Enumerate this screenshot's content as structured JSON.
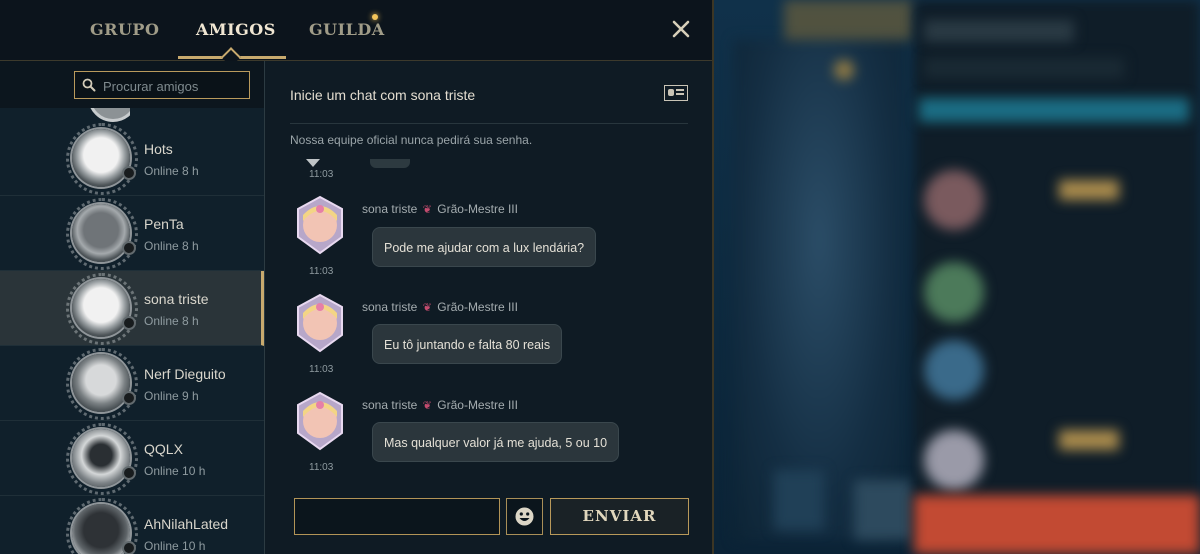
{
  "tabs": [
    {
      "label": "GRUPO"
    },
    {
      "label": "AMIGOS"
    },
    {
      "label": "GUILDA"
    }
  ],
  "search": {
    "placeholder": "Procurar amigos",
    "value": ""
  },
  "friends": [
    {
      "name": "Hots",
      "status": "Online 8 h"
    },
    {
      "name": "PenTa",
      "status": "Online 8 h"
    },
    {
      "name": "sona triste",
      "status": "Online 8 h"
    },
    {
      "name": "Nerf Dieguito",
      "status": "Online 9 h"
    },
    {
      "name": "QQLX",
      "status": "Online 10 h"
    },
    {
      "name": "AhNilahLated",
      "status": "Online 10 h"
    }
  ],
  "chat": {
    "title": "Inicie um chat com sona triste",
    "notice": "Nossa equipe oficial nunca pedirá sua senha.",
    "partial_timestamp": "11:03",
    "messages": [
      {
        "sender": "sona triste",
        "rank": "Grão-Mestre III",
        "text": "Pode me ajudar com a lux lendária?",
        "time": "11:03"
      },
      {
        "sender": "sona triste",
        "rank": "Grão-Mestre III",
        "text": "Eu tô juntando e falta 80 reais",
        "time": "11:03"
      },
      {
        "sender": "sona triste",
        "rank": "Grão-Mestre III",
        "text": "Mas qualquer valor já me ajuda, 5 ou 10",
        "time": "11:03"
      }
    ],
    "input_value": "",
    "send_label": "ENVIAR"
  },
  "colors": {
    "accent_gold": "#c8aa6e",
    "panel_bg": "#0f1b24",
    "selected_row": "#2a3439",
    "bubble_bg": "#2b363c",
    "rank_icon": "#c24b6e"
  },
  "icons": {
    "close": "close-icon",
    "search": "search-icon",
    "profile": "profile-card-icon",
    "emoji": "emoji-icon",
    "rank": "grandmaster-rank-icon"
  }
}
